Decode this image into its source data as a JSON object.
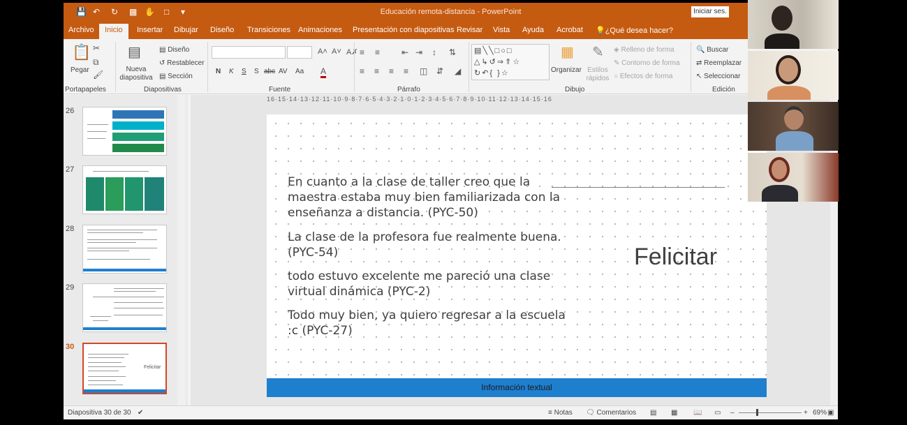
{
  "window": {
    "title": "Educación remota-distancia - PowerPoint",
    "signin_label": "Iniciar ses.",
    "accent": "#c55a11"
  },
  "tabs": [
    "Archivo",
    "Inicio",
    "Insertar",
    "Dibujar",
    "Diseño",
    "Transiciones",
    "Animaciones",
    "Presentación con diapositivas",
    "Revisar",
    "Vista",
    "Ayuda",
    "Acrobat",
    "¿Qué desea hacer?"
  ],
  "ribbon": {
    "groups": [
      "Portapapeles",
      "Diapositivas",
      "Fuente",
      "Párrafo",
      "Dibujo",
      "Edición"
    ],
    "paste": "Pegar",
    "new_slide": "Nueva diapositiva",
    "layout": "Diseño",
    "reset": "Restablecer",
    "section": "Sección",
    "font_buttons": [
      "N",
      "K",
      "S",
      "S",
      "abc",
      "AV",
      "Aa"
    ],
    "organize": "Organizar",
    "quick_styles": "Estilos rápidos",
    "shape_fill": "Relleno de forma",
    "shape_outline": "Contorno de forma",
    "shape_effects": "Efectos de forma",
    "find": "Buscar",
    "replace": "Reemplazar",
    "select": "Seleccionar"
  },
  "slides_pane": [
    {
      "number": "26"
    },
    {
      "number": "27"
    },
    {
      "number": "28"
    },
    {
      "number": "29"
    },
    {
      "number": "30",
      "active": true
    }
  ],
  "ruler_h": "16·15·14·13·12·11·10·9·8·7·6·5·4·3·2·1·0·1·2·3·4·5·6·7·8·9·10·11·12·13·14·15·16",
  "slide": {
    "quotes": [
      "En cuanto a la clase de taller creo que la maestra estaba muy bien familiarizada con la enseñanza a distancia. (PYC-50)",
      "La clase de la profesora fue realmente buena. (PYC-54)",
      "todo estuvo excelente me pareció una clase virtual dinámica (PYC-2)",
      "Todo muy bien, ya quiero regresar a la escuela :c  (PYC-27)"
    ],
    "title": "Felicitar",
    "footer": "Información textual"
  },
  "status": {
    "slide_counter": "Diapositiva 30 de 30",
    "notes": "Notas",
    "comments": "Comentarios",
    "zoom": "69%"
  }
}
